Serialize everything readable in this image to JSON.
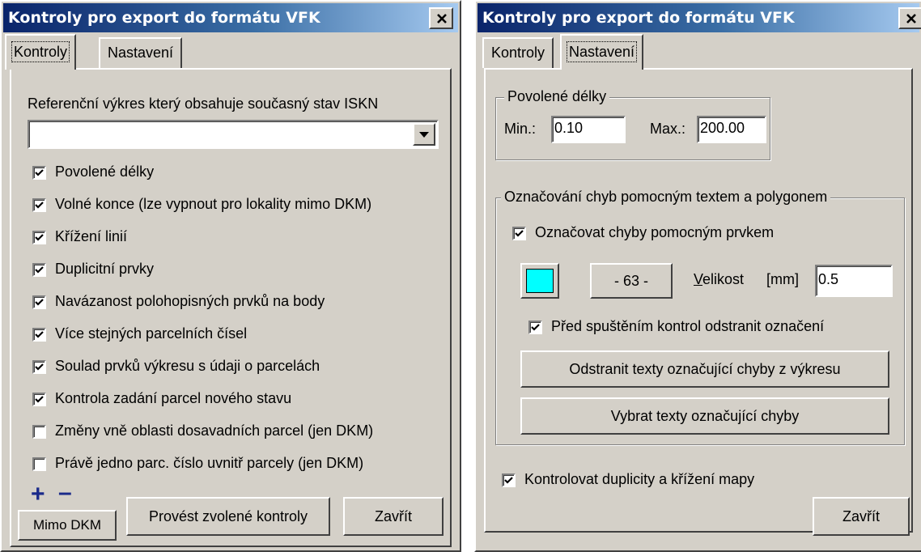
{
  "colors": {
    "face": "#d4d0c8",
    "title_start": "#0a246a",
    "title_end": "#a6caf0",
    "marker_swatch": "#00ffff",
    "plus_minus": "#1a2a8a"
  },
  "left_window": {
    "title": "Kontroly pro export do formátu VFK",
    "close_icon": "close-icon",
    "tabs": [
      {
        "label": "Kontroly",
        "active": true
      },
      {
        "label": "Nastavení",
        "active": false
      }
    ],
    "reference_label": "Referenční výkres který obsahuje současný stav ISKN",
    "reference_value": "",
    "checks": [
      {
        "label": "Povolené délky",
        "checked": true
      },
      {
        "label": "Volné konce (lze vypnout pro lokality mimo DKM)",
        "checked": true
      },
      {
        "label": "Křížení linií",
        "checked": true
      },
      {
        "label": "Duplicitní prvky",
        "checked": true
      },
      {
        "label": "Navázanost polohopisných prvků na body",
        "checked": true
      },
      {
        "label": "Více stejných parcelních čísel",
        "checked": true
      },
      {
        "label": "Soulad prvků výkresu s údaji o parcelách",
        "checked": true
      },
      {
        "label": "Kontrola zadání parcel nového stavu",
        "checked": true
      },
      {
        "label": "Změny vně oblasti dosavadních parcel (jen DKM)",
        "checked": false
      },
      {
        "label": "Právě jedno parc. číslo uvnitř parcely (jen DKM)",
        "checked": false
      }
    ],
    "plus": "+",
    "minus": "–",
    "mimo_button": "Mimo DKM",
    "run_button": "Provést zvolené kontroly",
    "close_button": "Zavřít"
  },
  "right_window": {
    "title": "Kontroly pro export do formátu VFK",
    "close_icon": "close-icon",
    "tabs": [
      {
        "label": "Kontroly",
        "active": false
      },
      {
        "label": "Nastavení",
        "active": true
      }
    ],
    "lengths_group": {
      "label": "Povolené délky",
      "min_label": "Min.:",
      "min_value": "0.10",
      "max_label": "Max.:",
      "max_value": "200.00"
    },
    "marking_group": {
      "label": "Označování chyb pomocným textem a polygonem",
      "mark_errors": {
        "label": "Označovat chyby pomocným prvkem",
        "checked": true
      },
      "level_button": "- 63 -",
      "size_label_accel": "V",
      "size_label_rest": "elikost",
      "size_unit": "[mm]",
      "size_value": "0.5",
      "remove_before": {
        "label": "Před spuštěním kontrol odstranit označení",
        "checked": true
      },
      "remove_texts_button": "Odstranit texty označující chyby z výkresu",
      "select_texts_button": "Vybrat texty označující chyby"
    },
    "check_map": {
      "label": "Kontrolovat duplicity a křížení mapy",
      "checked": true
    },
    "close_button": "Zavřít"
  }
}
